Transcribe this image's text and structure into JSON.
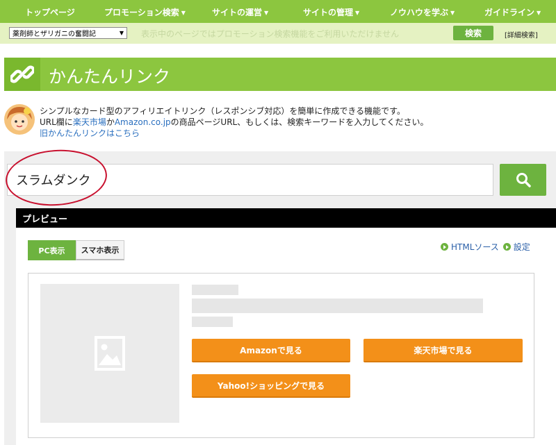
{
  "nav": {
    "items": [
      {
        "label": "トップページ",
        "caret": false
      },
      {
        "label": "プロモーション検索",
        "caret": true
      },
      {
        "label": "サイトの運営",
        "caret": true
      },
      {
        "label": "サイトの管理",
        "caret": true
      },
      {
        "label": "ノウハウを学ぶ",
        "caret": true
      },
      {
        "label": "ガイドライン",
        "caret": true
      }
    ]
  },
  "subbar": {
    "site_select": "薬剤師とザリガニの奮闘記",
    "notice": "表示中のページではプロモーション検索機能をご利用いただけません",
    "search_label": "検索",
    "detail_label": "[詳細検索]"
  },
  "page": {
    "title": "かんたんリンク"
  },
  "desc": {
    "line1": "シンプルなカード型のアフィリエイトリンク（レスポンシブ対応）を簡単に作成できる機能です。",
    "line2_pre": "URL欄に",
    "line2_link1": "楽天市場",
    "line2_mid": "か",
    "line2_link2": "Amazon.co.jp",
    "line2_post": "の商品ページURL、もしくは、検索キーワードを入力してください。",
    "old_link": "旧かんたんリンクはこちら"
  },
  "search": {
    "value": "スラムダンク"
  },
  "preview": {
    "header": "プレビュー",
    "tab_pc": "PC表示",
    "tab_sp": "スマホ表示",
    "html_source": "HTMLソース",
    "settings": "設定",
    "btn_amazon": "Amazonで見る",
    "btn_rakuten": "楽天市場で見る",
    "btn_yahoo": "Yahoo!ショッピングで見る"
  },
  "colors": {
    "brand_green": "#8cc63f",
    "button_green": "#6db33f",
    "orange": "#f39019",
    "annotation_red": "#c8102e"
  }
}
